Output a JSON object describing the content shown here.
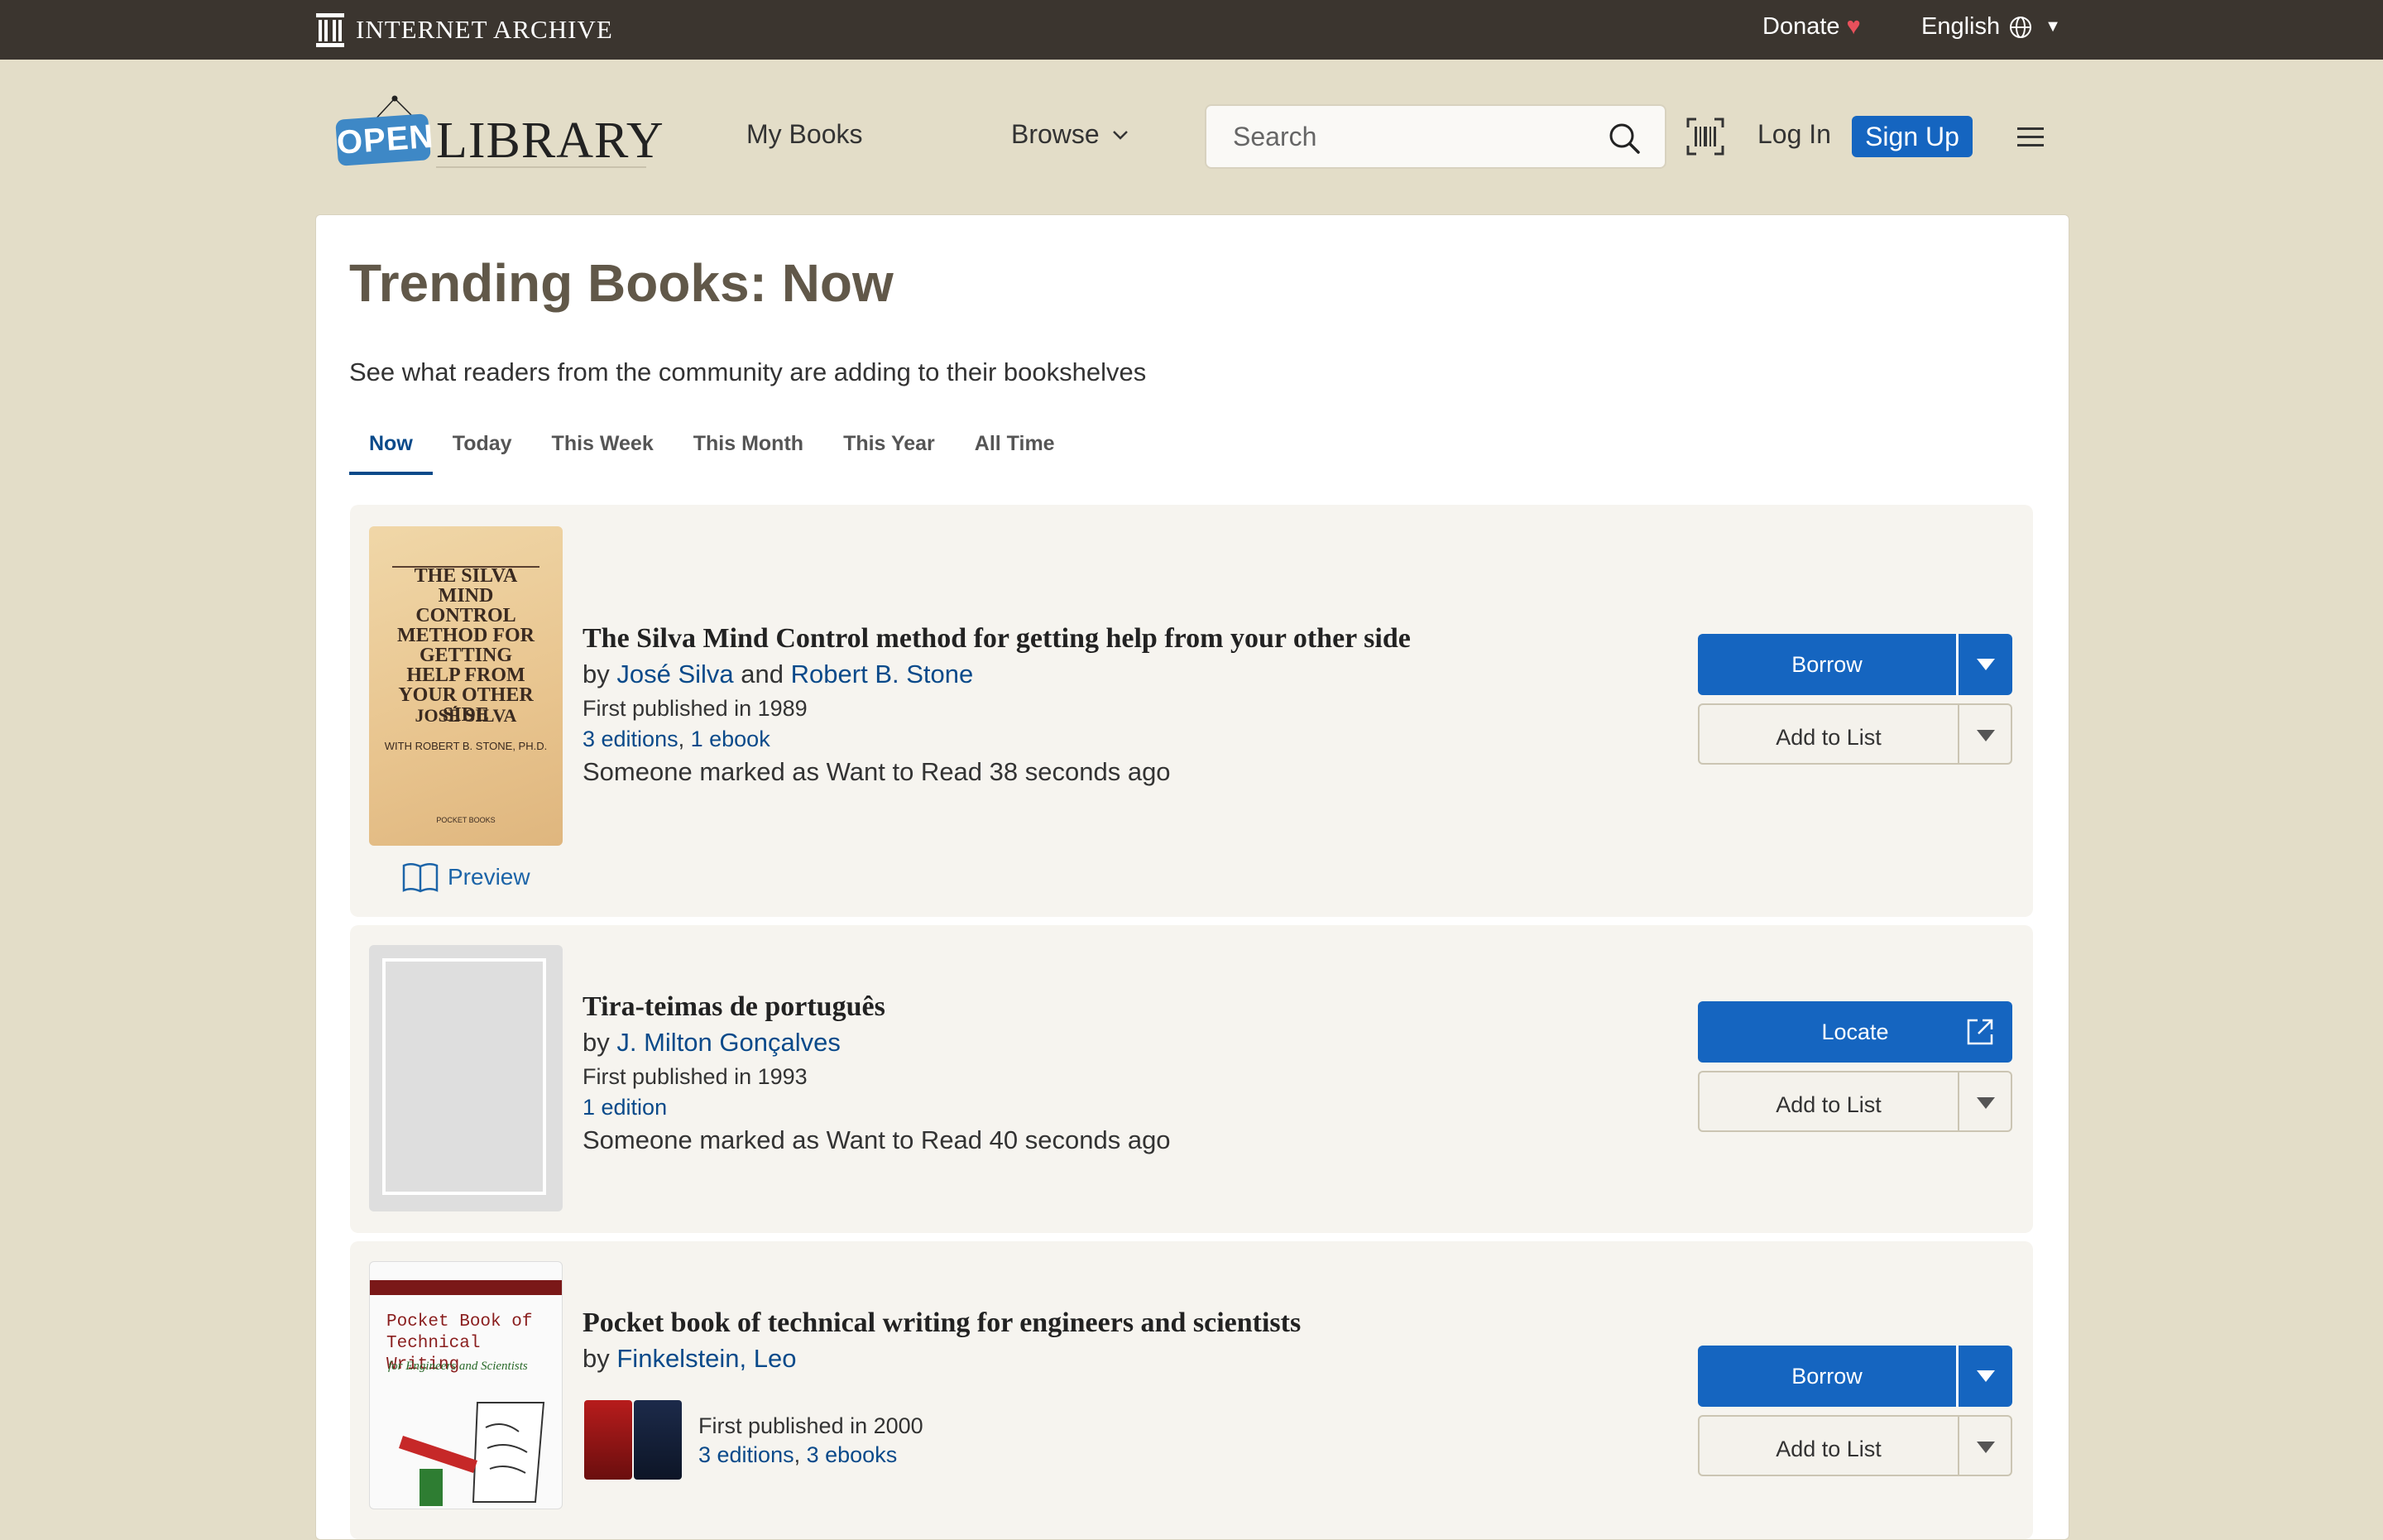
{
  "ia_bar": {
    "logo_text": "INTERNET ARCHIVE",
    "donate": "Donate",
    "donate_heart": "♥",
    "language": "English",
    "language_caret": "▼"
  },
  "header": {
    "logo_open": "OPEN",
    "logo_library": "LIBRARY",
    "my_books": "My Books",
    "browse": "Browse",
    "search_placeholder": "Search",
    "login": "Log In",
    "signup": "Sign Up"
  },
  "page": {
    "title": "Trending Books: Now",
    "subtitle": "See what readers from the community are adding to their bookshelves",
    "tabs": [
      {
        "label": "Now",
        "active": true
      },
      {
        "label": "Today"
      },
      {
        "label": "This Week"
      },
      {
        "label": "This Month"
      },
      {
        "label": "This Year"
      },
      {
        "label": "All Time"
      }
    ]
  },
  "books": [
    {
      "title": "The Silva Mind Control method for getting help from your other side",
      "by": "by",
      "author1": "José Silva",
      "and": "and",
      "author2": "Robert B. Stone",
      "published": "First published in 1989",
      "editions": "3 editions",
      "ebooks": "1 ebook",
      "marked": "Someone marked as Want to Read 38 seconds ago",
      "preview": "Preview",
      "primary_action": "Borrow",
      "list_action": "Add to List",
      "cover_title": "THE SILVA MIND CONTROL METHOD FOR GETTING HELP FROM YOUR OTHER SIDE",
      "cover_author": "JOSÉ SILVA",
      "cover_with": "WITH ROBERT B. STONE, PH.D.",
      "cover_publisher": "POCKET BOOKS"
    },
    {
      "title": "Tira-teimas de português",
      "by": "by",
      "author1": "J. Milton Gonçalves",
      "published": "First published in 1993",
      "editions": "1 edition",
      "marked": "Someone marked as Want to Read 40 seconds ago",
      "primary_action": "Locate",
      "list_action": "Add to List"
    },
    {
      "title": "Pocket book of technical writing for engineers and scientists",
      "by": "by",
      "author1": "Finkelstein, Leo",
      "published": "First published in 2000",
      "editions": "3 editions",
      "ebooks": "3 ebooks",
      "primary_action": "Borrow",
      "list_action": "Add to List",
      "cover_title": "Pocket Book of Technical Writing",
      "cover_subtitle": "for Engineers and Scientists"
    }
  ],
  "colors": {
    "page_bg": "#e3ddc8",
    "ia_bar": "#3b352f",
    "primary_blue": "#1565c0",
    "link_blue": "#0a4a8a",
    "title_brown": "#615849"
  }
}
